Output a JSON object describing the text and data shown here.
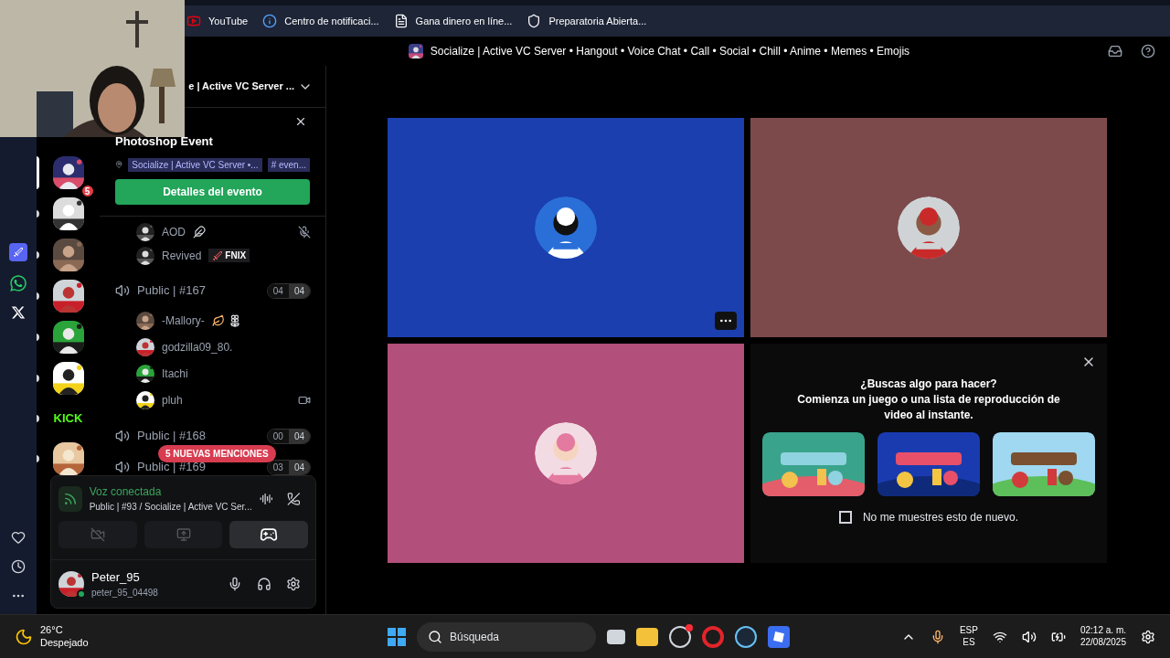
{
  "bookmarks": [
    {
      "label": "YouTube",
      "kind": "video"
    },
    {
      "label": "Centro de notificaci...",
      "kind": "info"
    },
    {
      "label": "Gana dinero en líne...",
      "kind": "doc"
    },
    {
      "label": "Preparatoria Abierta...",
      "kind": "shield"
    }
  ],
  "window": {
    "title": "Socialize | Active VC Server • Hangout • Voice Chat • Call • Social • Chill • Anime • Memes • Emojis"
  },
  "browser_sidebar": [
    {
      "kind": "app"
    },
    {
      "kind": "whatsapp"
    },
    {
      "kind": "x"
    }
  ],
  "servers": [
    {
      "kind": "picture",
      "badge": "5",
      "selected": true
    },
    {
      "kind": "picture",
      "selected": false
    },
    {
      "kind": "picture",
      "selected": false
    },
    {
      "kind": "picture",
      "selected": false
    },
    {
      "kind": "picture",
      "selected": false
    },
    {
      "kind": "picture",
      "selected": false
    },
    {
      "kind": "text",
      "label": "KICK",
      "selected": false
    },
    {
      "kind": "picture",
      "selected": false
    }
  ],
  "server_header": {
    "name": "e | Active VC Server ..."
  },
  "event": {
    "title": "Photoshop Event",
    "location": "Socialize | Active VC Server •...",
    "channel": "# even...",
    "button": "Detalles del evento"
  },
  "users_top": [
    {
      "name": "AOD",
      "kind": "feather",
      "muted": true
    },
    {
      "name": "Revived",
      "tag": "FNIX",
      "muted": false
    }
  ],
  "channels": [
    {
      "name": "Public | #167",
      "count": "04",
      "limit": "04",
      "users": [
        {
          "name": "-Mallory-",
          "kind": "leaf",
          "camera": false
        },
        {
          "name": "godzilla09_80.",
          "camera": false
        },
        {
          "name": "Itachi",
          "camera": false
        },
        {
          "name": "pluh",
          "camera": true
        }
      ]
    },
    {
      "name": "Public | #168",
      "count": "00",
      "limit": "04"
    },
    {
      "name": "Public | #169",
      "count": "03",
      "limit": "04"
    }
  ],
  "mentions": "5 NUEVAS MENCIONES",
  "voice": {
    "status": "Voz conectada",
    "channel": "Public | #93 / Socialize | Active VC Ser...",
    "buttons": [
      {
        "kind": "camera-off",
        "selected": false
      },
      {
        "kind": "share",
        "selected": false
      },
      {
        "kind": "activity",
        "selected": true
      }
    ]
  },
  "user": {
    "name": "Peter_95",
    "tag": "peter_95_04498"
  },
  "tiles": [
    {
      "color": "#1b3fae",
      "menu": true
    },
    {
      "color": "#7d4a4c",
      "menu": false
    },
    {
      "color": "#b24f7a",
      "menu": false
    }
  ],
  "promo": {
    "title": "¿Buscas algo para hacer?",
    "text": "Comienza un juego o una lista de reproducción de video al instante.",
    "games": [
      {
        "kind": "picture"
      },
      {
        "kind": "picture"
      },
      {
        "kind": "picture"
      }
    ],
    "checkbox": {
      "label": "No me muestres esto de nuevo.",
      "checked": false
    }
  },
  "taskbar": {
    "temperature": "26°C",
    "weather": "Despejado",
    "search": "Búsqueda",
    "lang": "ESP",
    "region": "ES",
    "time": "02:12 a. m.",
    "date": "22/08/2025"
  }
}
